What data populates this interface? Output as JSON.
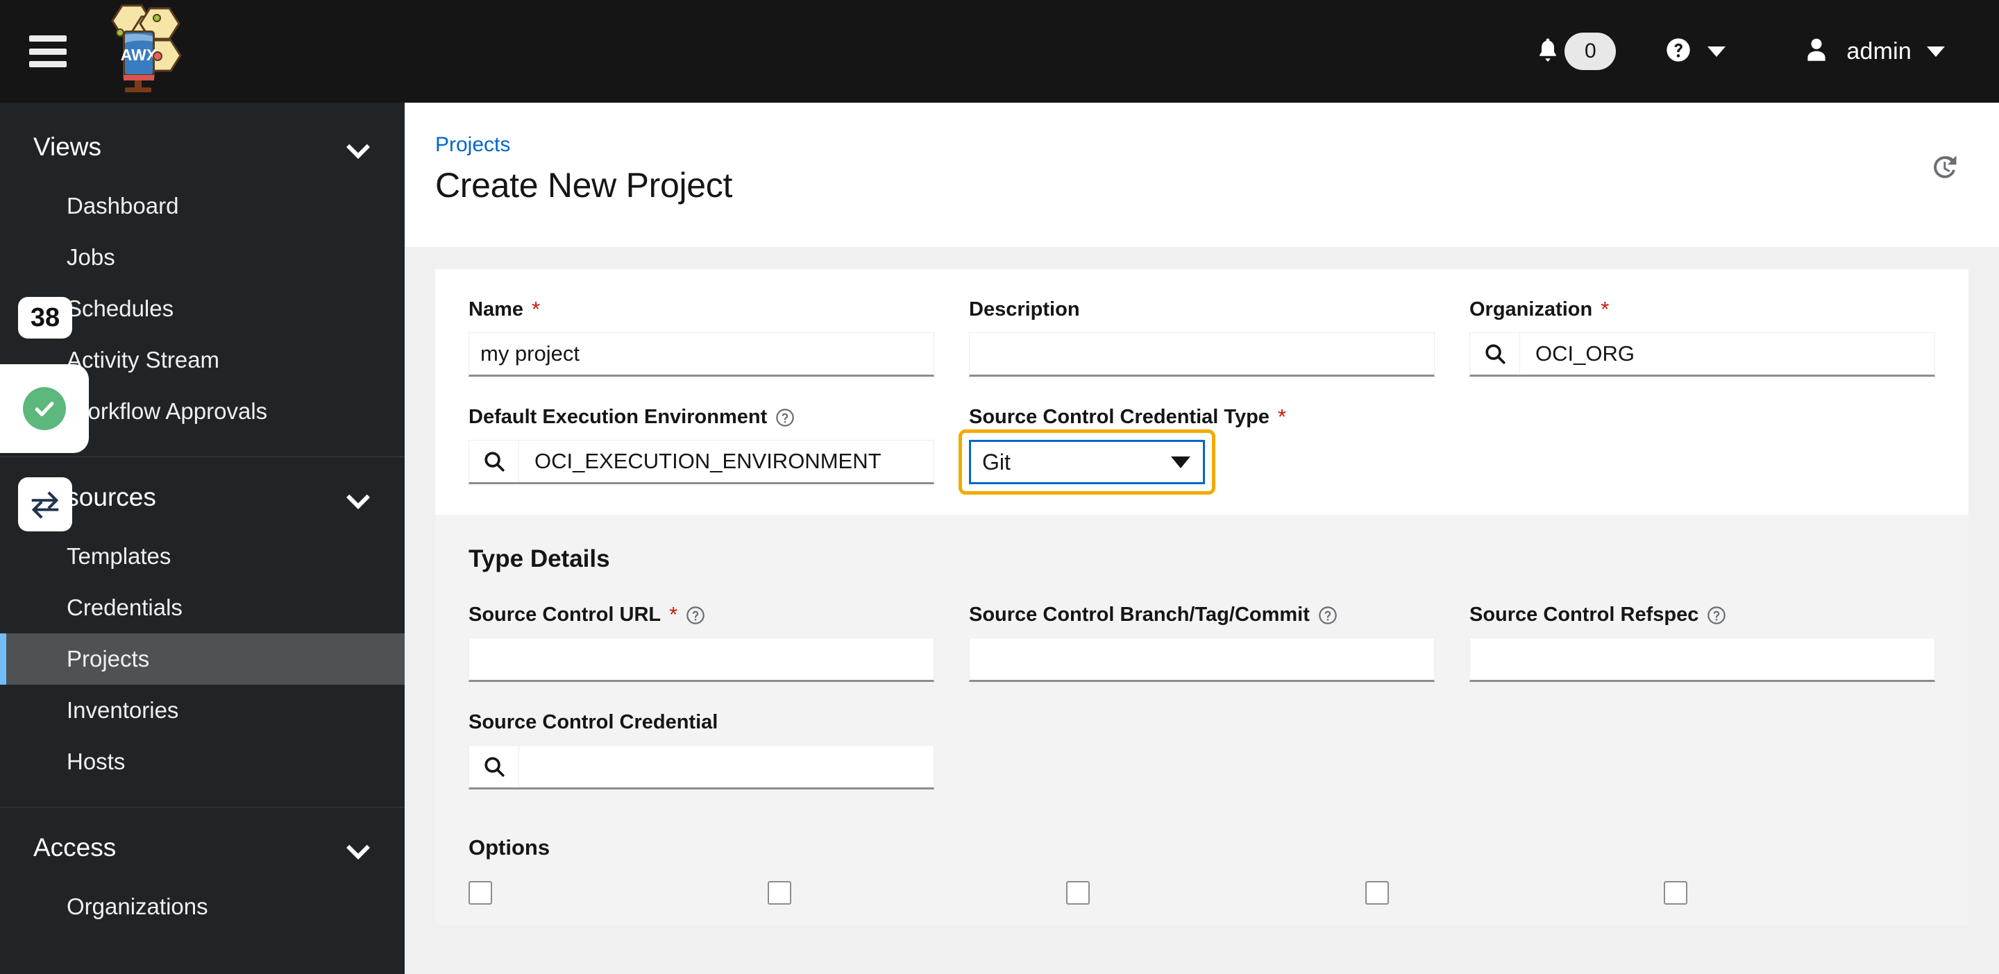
{
  "masthead": {
    "hamburger_icon": "hamburger-icon",
    "logo_text": "AWX",
    "notifications": {
      "icon": "bell-icon",
      "count": "0"
    },
    "help": {
      "icon": "question-circle-icon",
      "caret": "caret-down-icon"
    },
    "user": {
      "icon": "user-icon",
      "name": "admin",
      "caret": "caret-down-icon"
    }
  },
  "sidebar": {
    "groups": [
      {
        "label": "Views",
        "items": [
          {
            "label": "Dashboard",
            "active": false
          },
          {
            "label": "Jobs",
            "active": false
          },
          {
            "label": "Schedules",
            "active": false
          },
          {
            "label": "Activity Stream",
            "active": false
          },
          {
            "label": "Workflow Approvals",
            "active": false
          }
        ]
      },
      {
        "label": "Resources",
        "items": [
          {
            "label": "Templates",
            "active": false
          },
          {
            "label": "Credentials",
            "active": false
          },
          {
            "label": "Projects",
            "active": true
          },
          {
            "label": "Inventories",
            "active": false
          },
          {
            "label": "Hosts",
            "active": false
          }
        ]
      },
      {
        "label": "Access",
        "items": [
          {
            "label": "Organizations",
            "active": false
          }
        ]
      }
    ],
    "overlays": {
      "step_badge": "38",
      "status_icon": "check-circle-icon",
      "swap_icon": "exchange-arrows-icon"
    }
  },
  "page": {
    "breadcrumb": "Projects",
    "title": "Create New Project",
    "history_icon": "history-icon"
  },
  "form": {
    "row1": [
      {
        "label": "Name",
        "required": true,
        "help": false,
        "type": "text",
        "value": "my project",
        "placeholder": ""
      },
      {
        "label": "Description",
        "required": false,
        "help": false,
        "type": "text",
        "value": "",
        "placeholder": ""
      },
      {
        "label": "Organization",
        "required": true,
        "help": false,
        "type": "search",
        "value": "OCI_ORG",
        "placeholder": "",
        "search_icon": "search-icon"
      }
    ],
    "row2": [
      {
        "label": "Default Execution Environment",
        "required": false,
        "help": true,
        "type": "search",
        "value": "OCI_EXECUTION_ENVIRONMENT",
        "placeholder": "",
        "search_icon": "search-icon"
      },
      {
        "label": "Source Control Credential Type",
        "required": true,
        "help": false,
        "type": "select",
        "value": "Git",
        "focused": true,
        "caret_icon": "caret-down-icon"
      }
    ],
    "type_details": {
      "title": "Type Details",
      "row1": [
        {
          "label": "Source Control URL",
          "required": true,
          "help": true,
          "type": "text",
          "value": ""
        },
        {
          "label": "Source Control Branch/Tag/Commit",
          "required": false,
          "help": true,
          "type": "text",
          "value": ""
        },
        {
          "label": "Source Control Refspec",
          "required": false,
          "help": true,
          "type": "text",
          "value": ""
        }
      ],
      "credential": {
        "label": "Source Control Credential",
        "required": false,
        "help": false,
        "type": "search",
        "value": "",
        "search_icon": "search-icon"
      },
      "options_title": "Options",
      "option_checkboxes": [
        "checkbox",
        "checkbox",
        "checkbox",
        "checkbox",
        "checkbox"
      ]
    }
  },
  "colors": {
    "masthead_bg": "#151515",
    "sidebar_bg": "#212427",
    "active_nav_bg": "#4f5255",
    "active_nav_accent": "#73bcf7",
    "link_blue": "#0066cc",
    "required_red": "#c9190b",
    "focus_ring_amber": "#f0ab00",
    "focus_border_blue": "#0066cc",
    "success_green": "#5cb87c"
  }
}
